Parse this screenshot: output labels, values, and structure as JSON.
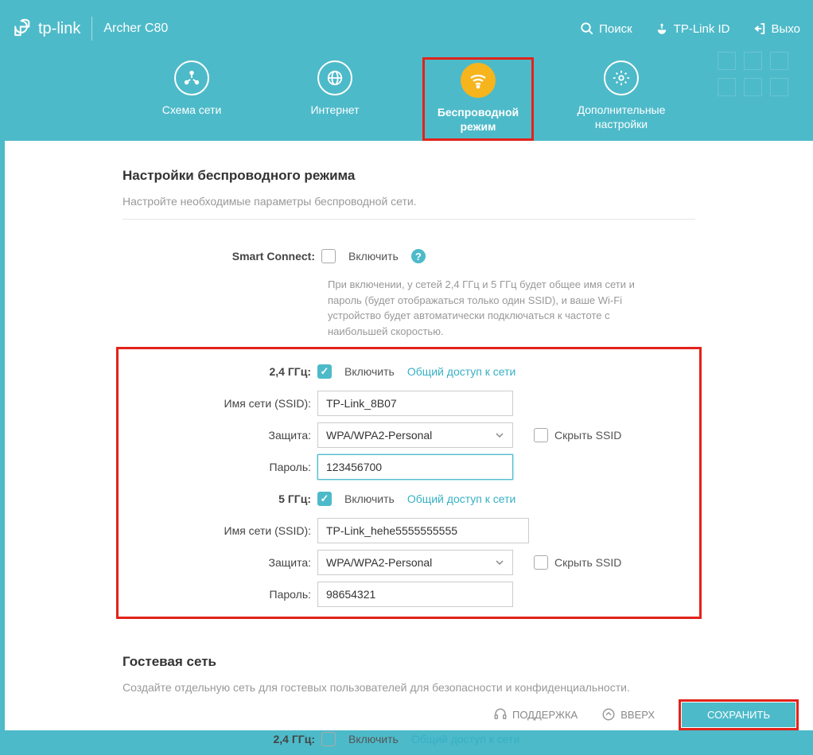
{
  "header": {
    "brand": "tp-link",
    "model": "Archer C80",
    "search": "Поиск",
    "tplink_id": "TP-Link ID",
    "logout": "Выхо"
  },
  "tabs": {
    "network": "Схема сети",
    "internet": "Интернет",
    "wireless": "Беспроводной\nрежим",
    "advanced": "Дополнительные\nнастройки"
  },
  "wireless": {
    "title": "Настройки беспроводного режима",
    "desc": "Настройте необходимые параметры беспроводной сети.",
    "smart_connect_label": "Smart Connect:",
    "enable_label": "Включить",
    "smart_hint": "При включении, у сетей 2,4 ГГц и 5 ГГц будет общее имя сети и пароль (будет отображаться только один SSID), и ваше Wi-Fi устройство будет автоматически подключаться к частоте с наибольшей скоростью.",
    "band24_label": "2,4 ГГц:",
    "band5_label": "5 ГГц:",
    "share_link": "Общий доступ к сети",
    "ssid_label": "Имя сети (SSID):",
    "security_label": "Защита:",
    "password_label": "Пароль:",
    "hide_ssid": "Скрыть SSID",
    "security_value": "WPA/WPA2-Personal",
    "band24": {
      "ssid": "TP-Link_8B07",
      "password": "123456700"
    },
    "band5": {
      "ssid": "TP-Link_hehe5555555555",
      "password": "98654321"
    }
  },
  "guest": {
    "title": "Гостевая сеть",
    "desc": "Создайте отдельную сеть для гостевых пользователей для безопасности и конфиденциальности.",
    "band24_label": "2,4 ГГц:"
  },
  "footer": {
    "support": "ПОДДЕРЖКА",
    "top": "ВВЕРХ",
    "save": "СОХРАНИТЬ"
  }
}
